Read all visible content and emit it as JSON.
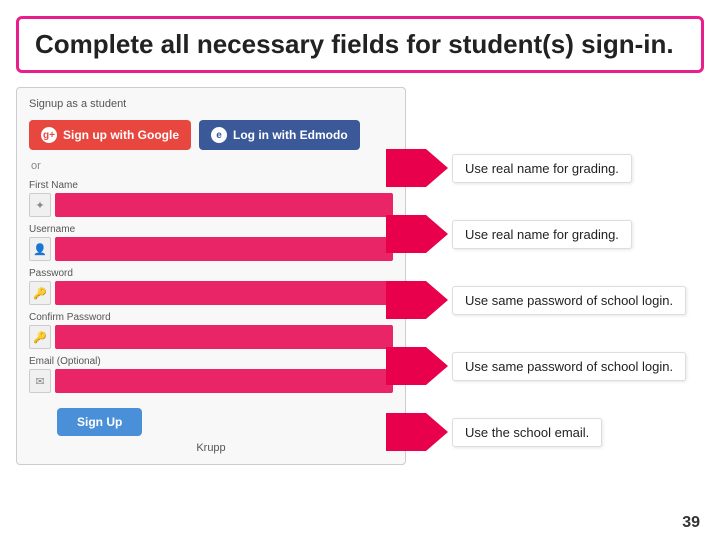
{
  "title": "Complete all necessary fields for student(s) sign-in.",
  "form": {
    "panel_title": "Signup as a student",
    "btn_google": "Sign up with Google",
    "btn_edmodo": "Log in with Edmodo",
    "or_text": "or",
    "fields": [
      {
        "label": "First Name",
        "icon": "✦"
      },
      {
        "label": "Username",
        "icon": "👤"
      },
      {
        "label": "Password",
        "icon": "🔑"
      },
      {
        "label": "Confirm Password",
        "icon": "🔑"
      },
      {
        "label": "Email (Optional)",
        "icon": "✉"
      }
    ],
    "signup_btn": "Sign Up",
    "krupp_label": "Krupp"
  },
  "annotations": [
    {
      "id": "ann-1",
      "text": "Use real name for grading."
    },
    {
      "id": "ann-2",
      "text": "Use real name for grading."
    },
    {
      "id": "ann-3",
      "text": "Use same password of school login."
    },
    {
      "id": "ann-4",
      "text": "Use same password of school login."
    },
    {
      "id": "ann-5",
      "text": "Use the school email."
    }
  ],
  "page_number": "39"
}
